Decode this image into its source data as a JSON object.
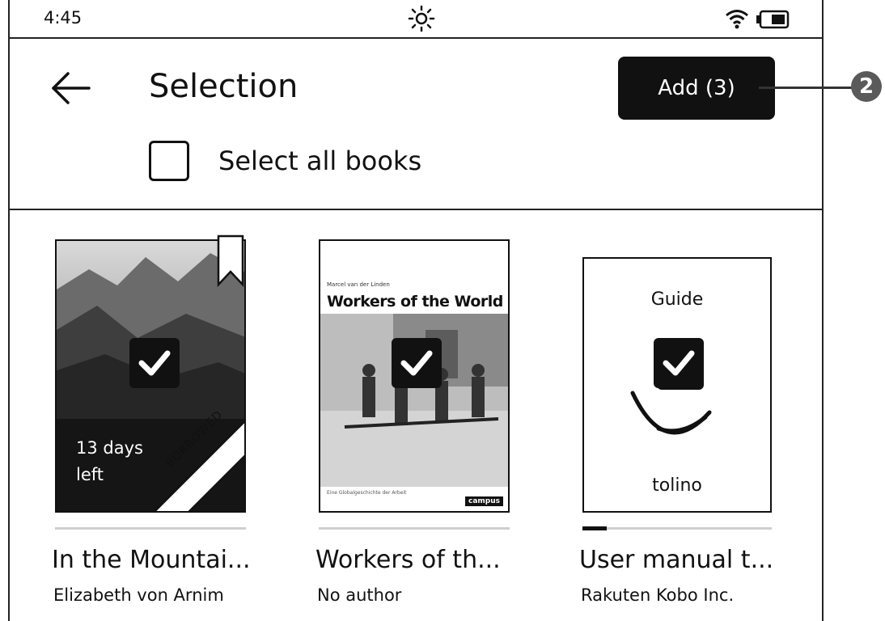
{
  "status_bar": {
    "time": "4:45",
    "icons": [
      "sun-icon",
      "wifi-icon",
      "battery-icon"
    ]
  },
  "header": {
    "title": "Selection",
    "add_button_label": "Add (3)",
    "select_all_label": "Select all books",
    "select_all_checked": false,
    "callout_number": "2"
  },
  "books": [
    {
      "title": "In the Mountai...",
      "author": "Elizabeth von Arnim",
      "selected": true,
      "loan_days_left": "13 days",
      "loan_left_word": "left",
      "badge": "BORROWED",
      "bookmarked": true,
      "progress": 0
    },
    {
      "title": "Workers of th...",
      "author": "No author",
      "selected": true,
      "cover_small_text": "Marcel van der Linden",
      "cover_title": "Workers of the World",
      "cover_subtitle": "Eine Globalgeschichte der Arbeit",
      "publisher": "campus",
      "progress": 0
    },
    {
      "title": "User manual t...",
      "author": "Rakuten Kobo Inc.",
      "selected": true,
      "cover_title": "Guide",
      "cover_brand": "tolino",
      "progress": 0.13
    }
  ],
  "colors": {
    "ink": "#111111",
    "paper": "#ffffff",
    "callout": "#5a5a5a"
  }
}
